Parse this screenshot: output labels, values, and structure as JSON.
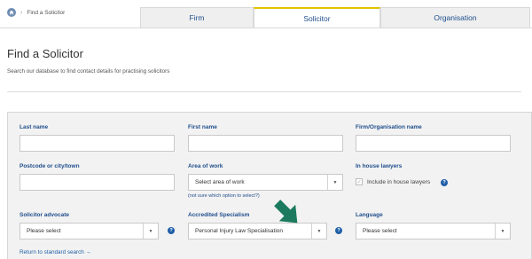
{
  "breadcrumb": {
    "current": "Find a Solicitor"
  },
  "tabs": [
    "Firm",
    "Solicitor",
    "Organisation"
  ],
  "header": {
    "title": "Find a Solicitor",
    "subtitle": "Search our database to find contact details for practising solicitors"
  },
  "form": {
    "last_name_label": "Last name",
    "first_name_label": "First name",
    "org_name_label": "Firm/Organisation name",
    "postcode_label": "Postcode or city/town",
    "area_label": "Area of work",
    "area_value": "Select area of work",
    "area_note": "(not sure which option to select?)",
    "in_house_label": "In house lawyers",
    "in_house_check_label": "Include in house lawyers",
    "advocate_label": "Solicitor advocate",
    "advocate_value": "Please select",
    "specialism_label": "Accredited Specialism",
    "specialism_value": "Personal Injury Law Specialisation",
    "language_label": "Language",
    "language_value": "Please select",
    "return_link": "Return to standard search →"
  },
  "colors": {
    "accent": "#1f4e8c",
    "tab_highlight": "#e2c200",
    "arrow": "#1b7a5e"
  }
}
